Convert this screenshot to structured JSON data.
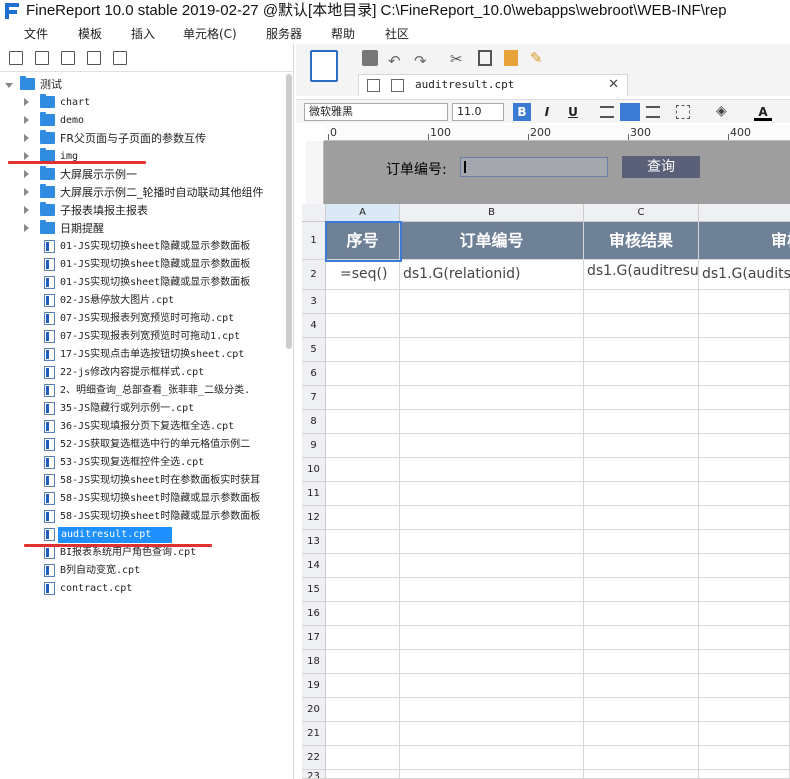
{
  "window": {
    "title": "FineReport 10.0 stable 2019-02-27 @默认[本地目录]    C:\\FineReport_10.0\\webapps\\webroot\\WEB-INF\\rep"
  },
  "menu": [
    "文件",
    "模板",
    "插入",
    "单元格(C)",
    "服务器",
    "帮助",
    "社区"
  ],
  "tree": {
    "root": "测试",
    "folders": [
      "chart",
      "demo",
      "FR父页面与子页面的参数互传",
      "img",
      "大屏展示示例一",
      "大屏展示示例二_轮播时自动联动其他组件",
      "子报表填报主报表",
      "日期提醒"
    ],
    "files": [
      "01-JS实现切换sheet隐藏或显示参数面板",
      "01-JS实现切换sheet隐藏或显示参数面板",
      "01-JS实现切换sheet隐藏或显示参数面板",
      "02-JS悬停放大图片.cpt",
      "07-JS实现报表列宽预览时可拖动.cpt",
      "07-JS实现报表列宽预览时可拖动1.cpt",
      "17-JS实现点击单选按钮切换sheet.cpt",
      "22-js修改内容提示框样式.cpt",
      "2、明细查询_总部查看_张菲菲_二级分类.",
      "35-JS隐藏行或列示例一.cpt",
      "36-JS实现填报分页下复选框全选.cpt",
      "52-JS获取复选框选中行的单元格值示例二",
      "53-JS实现复选框控件全选.cpt",
      "58-JS实现切换sheet时在参数面板实时获耳",
      "58-JS实现切换sheet时隐藏或显示参数面板",
      "58-JS实现切换sheet时隐藏或显示参数面板",
      "auditresult.cpt",
      "BI报表系统用户角色查询.cpt",
      "B列自动变宽.cpt",
      "contract.cpt"
    ]
  },
  "tab": {
    "name": "auditresult.cpt",
    "close": "✕"
  },
  "format": {
    "font": "微软雅黑",
    "size": "11.0",
    "bold": "B",
    "italic": "I",
    "underline": "U",
    "fontcolor": "A"
  },
  "ruler": [
    "0",
    "100",
    "200",
    "300",
    "400"
  ],
  "param": {
    "label": "订单编号:",
    "query": "查询"
  },
  "sheet": {
    "columns": [
      "A",
      "B",
      "C",
      ""
    ],
    "rows": [
      "1",
      "2",
      "3",
      "4",
      "5",
      "6",
      "7",
      "8",
      "9",
      "10",
      "11",
      "12",
      "13",
      "14",
      "15",
      "16",
      "17",
      "18",
      "19",
      "20",
      "21",
      "22",
      "23"
    ],
    "header": [
      "序号",
      "订单编号",
      "审核结果",
      "审核"
    ],
    "row2": [
      "=seq()",
      "ds1.G(relationid)",
      "ds1.G(auditresult)",
      "ds1.G(auditsu"
    ]
  },
  "colors": {
    "header_bg": "#6f8197",
    "selection": "#1e90ff",
    "query_btn": "#5b6079",
    "annotation": "#e03030"
  }
}
